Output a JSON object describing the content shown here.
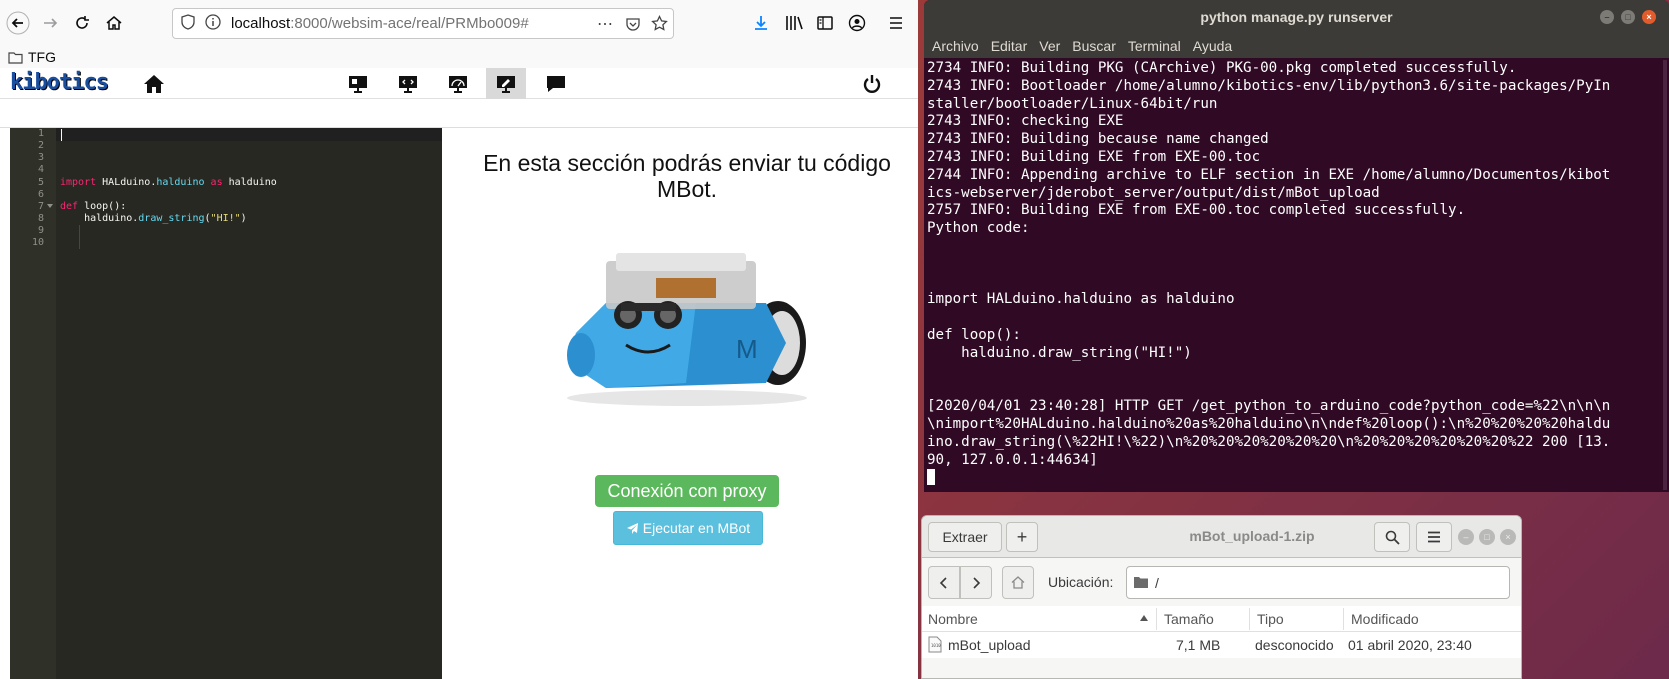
{
  "browser": {
    "url_host": "localhost",
    "url_path": ":8000/websim-ace/real/PRMbo009#",
    "bookmark_folder": "TFG",
    "more_icon": "⋯"
  },
  "kibotics": {
    "logo": "kibotics"
  },
  "editor": {
    "line_numbers": [
      "1",
      "2",
      "3",
      "4",
      "5",
      "6",
      "7",
      "8",
      "9",
      "10"
    ],
    "import_kw": "import",
    "import_mod1": "HALduino.",
    "import_mod2": "halduino",
    "import_as": "as",
    "import_alias": "halduino",
    "def_kw": "def",
    "def_sig": "loop():",
    "call_obj": "halduino.",
    "call_fn": "draw_string",
    "call_open": "(",
    "call_str": "\"HI!\"",
    "call_close": ")"
  },
  "sim": {
    "title": "En esta sección podrás enviar tu código MBot.",
    "proxy_button": "Conexión con proxy",
    "run_button": "Ejecutar en MBot"
  },
  "terminal": {
    "title": "python manage.py runserver",
    "menu": [
      "Archivo",
      "Editar",
      "Ver",
      "Buscar",
      "Terminal",
      "Ayuda"
    ],
    "lines": [
      "2734 INFO: Building PKG (CArchive) PKG-00.pkg completed successfully.",
      "2743 INFO: Bootloader /home/alumno/kibotics-env/lib/python3.6/site-packages/PyIn",
      "staller/bootloader/Linux-64bit/run",
      "2743 INFO: checking EXE",
      "2743 INFO: Building because name changed",
      "2743 INFO: Building EXE from EXE-00.toc",
      "2744 INFO: Appending archive to ELF section in EXE /home/alumno/Documentos/kibot",
      "ics-webserver/jderobot_server/output/dist/mBot_upload",
      "2757 INFO: Building EXE from EXE-00.toc completed successfully.",
      "Python code:",
      "",
      "",
      "",
      "import HALduino.halduino as halduino",
      "",
      "def loop():",
      "    halduino.draw_string(\"HI!\")",
      "",
      "",
      "[2020/04/01 23:40:28] HTTP GET /get_python_to_arduino_code?python_code=%22\\n\\n\\n",
      "\\nimport%20HALduino.halduino%20as%20halduino\\n\\ndef%20loop():\\n%20%20%20%20haldu",
      "ino.draw_string(\\%22HI!\\%22)\\n%20%20%20%20%20%20\\n%20%20%20%20%20%20%22 200 [13.",
      "90, 127.0.0.1:44634]"
    ]
  },
  "archive": {
    "title": "mBot_upload-1.zip",
    "extract_button": "Extraer",
    "add_button": "+",
    "location_label": "Ubicación:",
    "location_value": "/",
    "columns": [
      "Nombre",
      "Tamaño",
      "Tipo",
      "Modificado"
    ],
    "files": [
      {
        "name": "mBot_upload",
        "size": "7,1 MB",
        "type": "desconocido",
        "modified": "01 abril 2020, 23:40"
      }
    ]
  }
}
